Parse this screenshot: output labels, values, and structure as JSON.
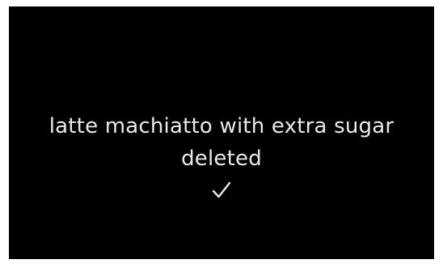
{
  "notification": {
    "item_name": "latte machiatto with extra sugar",
    "status": "deleted",
    "icon": "checkmark-icon"
  },
  "colors": {
    "background": "#000000",
    "text": "#e9e9e9",
    "frame": "#ffffff"
  }
}
